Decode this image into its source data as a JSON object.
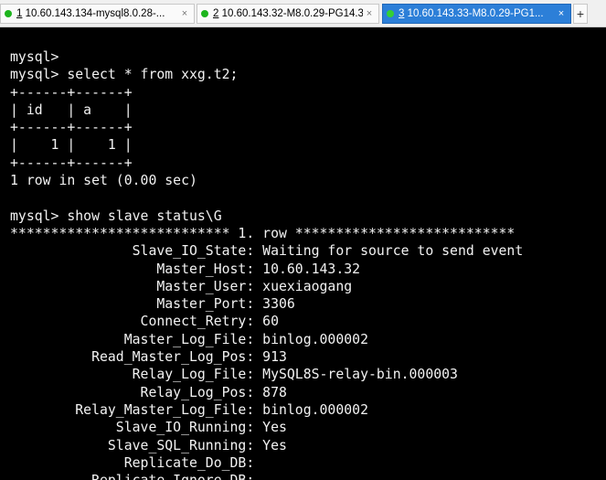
{
  "tabs": [
    {
      "num": "1",
      "title": " 10.60.143.134-mysql8.0.28-...",
      "close": "×"
    },
    {
      "num": "2",
      "title": " 10.60.143.32-M8.0.29-PG14.3",
      "close": "×"
    },
    {
      "num": "3",
      "title": " 10.60.143.33-M8.0.29-PG1...",
      "close": "×"
    }
  ],
  "new_tab_label": "+",
  "terminal": {
    "lines": [
      "mysql>",
      "mysql> select * from xxg.t2;",
      "+------+------+",
      "| id   | a    |",
      "+------+------+",
      "|    1 |    1 |",
      "+------+------+",
      "1 row in set (0.00 sec)",
      "",
      "mysql> show slave status\\G",
      "*************************** 1. row ***************************",
      "               Slave_IO_State: Waiting for source to send event",
      "                  Master_Host: 10.60.143.32",
      "                  Master_User: xuexiaogang",
      "                  Master_Port: 3306",
      "                Connect_Retry: 60",
      "              Master_Log_File: binlog.000002",
      "          Read_Master_Log_Pos: 913",
      "               Relay_Log_File: MySQL8S-relay-bin.000003",
      "                Relay_Log_Pos: 878",
      "        Relay_Master_Log_File: binlog.000002",
      "             Slave_IO_Running: Yes",
      "            Slave_SQL_Running: Yes",
      "              Replicate_Do_DB:",
      "          Replicate_Ignore_DB:"
    ]
  }
}
